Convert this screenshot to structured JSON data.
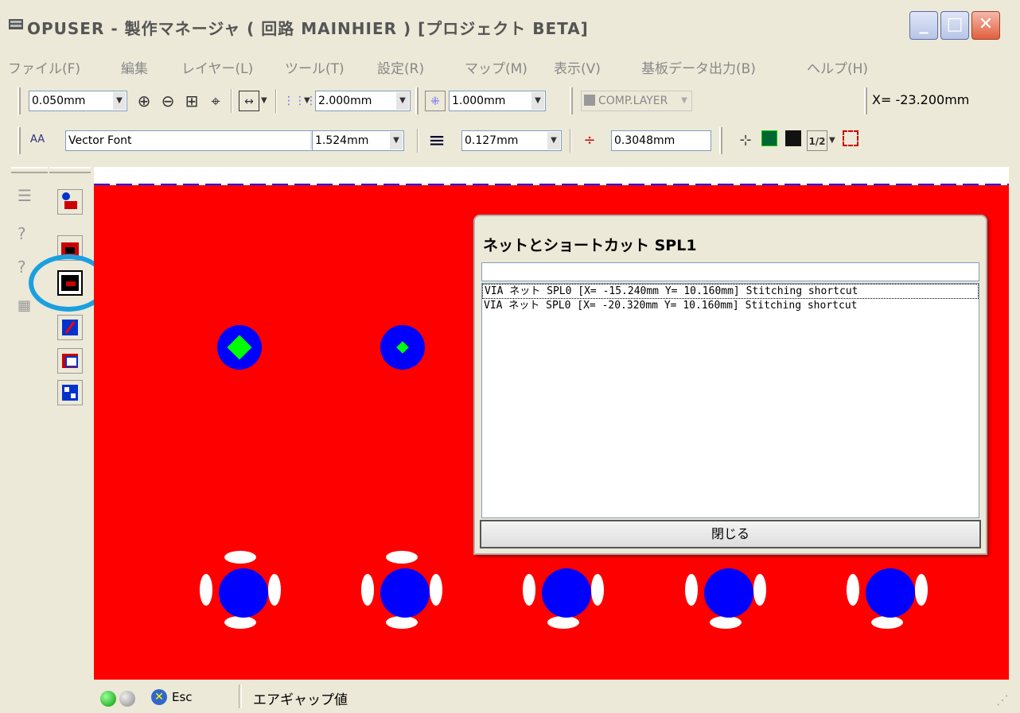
{
  "window": {
    "title": "OPUSER - 製作マネージャ ( 回路 MAINHIER ) [プロジェクト BETA]",
    "minimize_label": "_",
    "maximize_label": "□",
    "close_label": "✕"
  },
  "menu": {
    "items": [
      {
        "label": "ファイル(F)"
      },
      {
        "label": "編集"
      },
      {
        "label": "レイヤー(L)"
      },
      {
        "label": "ツール(T)"
      },
      {
        "label": "設定(R)"
      },
      {
        "label": "マップ(M)"
      },
      {
        "label": "表示(V)"
      },
      {
        "label": "基板データ出力(B)"
      },
      {
        "label": "ヘルプ(H)"
      }
    ]
  },
  "toolbar1": {
    "grid_size": "0.050mm",
    "snap_grid": "2.000mm",
    "display_grid": "1.000mm",
    "layer": "COMP.LAYER",
    "x_coord": "X= -23.200mm"
  },
  "toolbar2": {
    "font_prefix": "AA",
    "font": "Vector Font",
    "text_size": "1.524mm",
    "line_width": "0.127mm",
    "clearance": "0.3048mm",
    "ratio": "1/2"
  },
  "dialog": {
    "title": "ネットとショートカット SPL1",
    "search_value": "",
    "rows": [
      {
        "text": "VIA ネット SPL0 [X= -15.240mm Y= 10.160mm] Stitching shortcut"
      },
      {
        "text": "VIA ネット SPL0 [X= -20.320mm Y= 10.160mm] Stitching shortcut"
      }
    ],
    "close_label": "閉じる"
  },
  "status": {
    "esc_label": "Esc",
    "message": "エアギャップ値"
  },
  "colors": {
    "board": "#ff0000",
    "via": "#0000ff",
    "via_core": "#00ff00",
    "highlight_ring": "#1aa0e0"
  }
}
